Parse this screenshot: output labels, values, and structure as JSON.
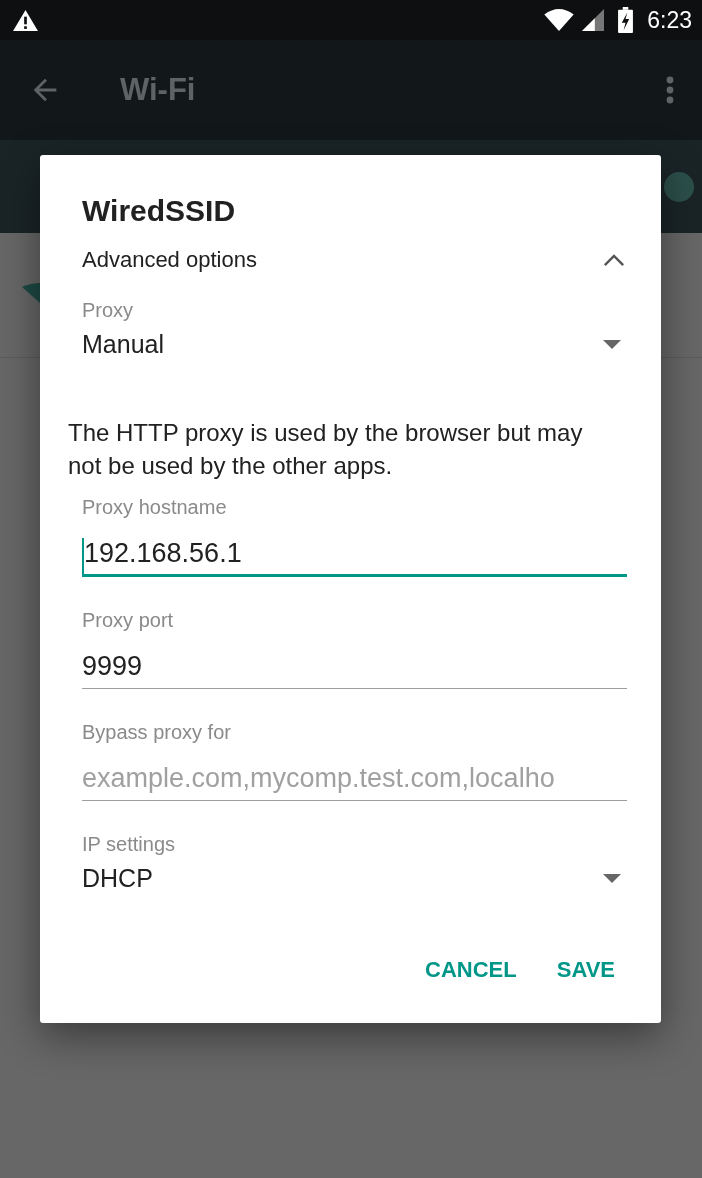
{
  "status_bar": {
    "time": "6:23"
  },
  "app_bar": {
    "title": "Wi-Fi"
  },
  "wifi_toggle": {
    "on": true
  },
  "dialog": {
    "title": "WiredSSID",
    "advanced_options": {
      "label": "Advanced options",
      "expanded": true
    },
    "proxy": {
      "label": "Proxy",
      "value": "Manual"
    },
    "note": "The HTTP proxy is used by the browser but may not be used by the other apps.",
    "fields": [
      {
        "label": "Proxy hostname",
        "value": "192.168.56.1",
        "focused": true
      },
      {
        "label": "Proxy port",
        "value": "9999",
        "focused": false
      },
      {
        "label": "Bypass proxy for",
        "placeholder": "example.com,mycomp.test.com,localho",
        "focused": false
      }
    ],
    "ip_settings": {
      "label": "IP settings",
      "value": "DHCP"
    },
    "buttons": [
      "CANCEL",
      "SAVE"
    ]
  }
}
